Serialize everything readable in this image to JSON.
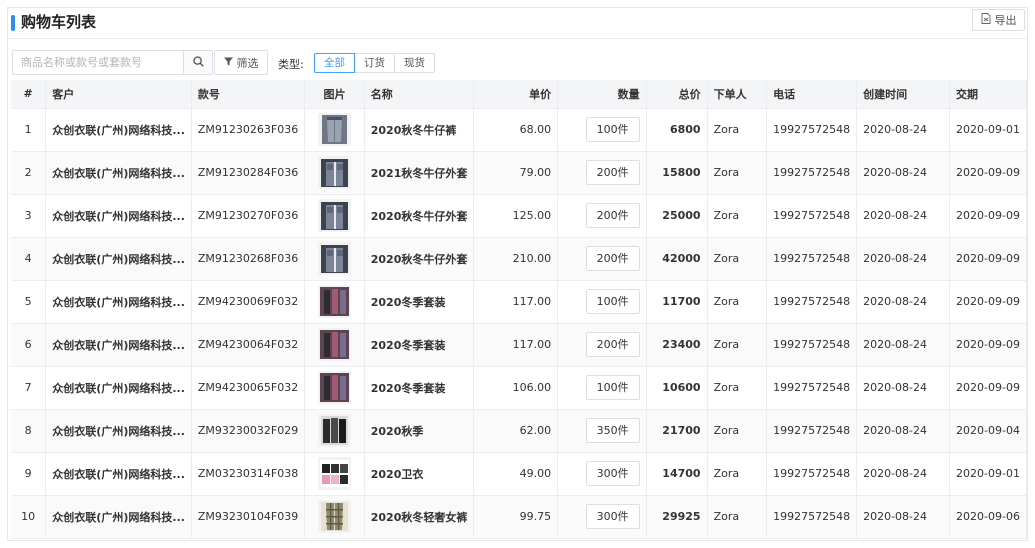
{
  "page": {
    "title": "购物车列表",
    "accent_color": "#2d8cf0",
    "export_label": "导出"
  },
  "toolbar": {
    "search_placeholder": "商品名称或款号或套款号",
    "filter_label": "筛选",
    "type_label": "类型:",
    "type_options": [
      "全部",
      "订货",
      "现货"
    ],
    "type_selected": "全部"
  },
  "table": {
    "columns": [
      "#",
      "客户",
      "款号",
      "图片",
      "名称",
      "单价",
      "数量",
      "总价",
      "下单人",
      "电话",
      "创建时间",
      "交期"
    ],
    "rows": [
      {
        "idx": "1",
        "customer": "众创衣联(广州)网络科技...",
        "sku": "ZM91230263F036",
        "thumb": "jeans-icon",
        "name": "2020秋冬牛仔裤",
        "price": "68.00",
        "qty": "100件",
        "total": "6800",
        "user": "Zora",
        "phone": "19927572548",
        "created": "2020-08-24",
        "delivery": "2020-09-01"
      },
      {
        "idx": "2",
        "customer": "众创衣联(广州)网络科技...",
        "sku": "ZM91230284F036",
        "thumb": "denim-jacket-icon",
        "name": "2021秋冬牛仔外套",
        "price": "79.00",
        "qty": "200件",
        "total": "15800",
        "user": "Zora",
        "phone": "19927572548",
        "created": "2020-08-24",
        "delivery": "2020-09-09"
      },
      {
        "idx": "3",
        "customer": "众创衣联(广州)网络科技...",
        "sku": "ZM91230270F036",
        "thumb": "denim-jacket-icon",
        "name": "2020秋冬牛仔外套",
        "price": "125.00",
        "qty": "200件",
        "total": "25000",
        "user": "Zora",
        "phone": "19927572548",
        "created": "2020-08-24",
        "delivery": "2020-09-09"
      },
      {
        "idx": "4",
        "customer": "众创衣联(广州)网络科技...",
        "sku": "ZM91230268F036",
        "thumb": "denim-jacket-icon",
        "name": "2020秋冬牛仔外套",
        "price": "210.00",
        "qty": "200件",
        "total": "42000",
        "user": "Zora",
        "phone": "19927572548",
        "created": "2020-08-24",
        "delivery": "2020-09-09"
      },
      {
        "idx": "5",
        "customer": "众创衣联(广州)网络科技...",
        "sku": "ZM94230069F032",
        "thumb": "winter-suit-icon",
        "name": "2020冬季套装",
        "price": "117.00",
        "qty": "100件",
        "total": "11700",
        "user": "Zora",
        "phone": "19927572548",
        "created": "2020-08-24",
        "delivery": "2020-09-09"
      },
      {
        "idx": "6",
        "customer": "众创衣联(广州)网络科技...",
        "sku": "ZM94230064F032",
        "thumb": "winter-suit-icon",
        "name": "2020冬季套装",
        "price": "117.00",
        "qty": "200件",
        "total": "23400",
        "user": "Zora",
        "phone": "19927572548",
        "created": "2020-08-24",
        "delivery": "2020-09-09"
      },
      {
        "idx": "7",
        "customer": "众创衣联(广州)网络科技...",
        "sku": "ZM94230065F032",
        "thumb": "winter-suit-icon",
        "name": "2020冬季套装",
        "price": "106.00",
        "qty": "100件",
        "total": "10600",
        "user": "Zora",
        "phone": "19927572548",
        "created": "2020-08-24",
        "delivery": "2020-09-09"
      },
      {
        "idx": "8",
        "customer": "众创衣联(广州)网络科技...",
        "sku": "ZM93230032F029",
        "thumb": "autumn-wear-icon",
        "name": "2020秋季",
        "price": "62.00",
        "qty": "350件",
        "total": "21700",
        "user": "Zora",
        "phone": "19927572548",
        "created": "2020-08-24",
        "delivery": "2020-09-04"
      },
      {
        "idx": "9",
        "customer": "众创衣联(广州)网络科技...",
        "sku": "ZM03230314F038",
        "thumb": "hoodie-icon",
        "name": "2020卫衣",
        "price": "49.00",
        "qty": "300件",
        "total": "14700",
        "user": "Zora",
        "phone": "19927572548",
        "created": "2020-08-24",
        "delivery": "2020-09-01"
      },
      {
        "idx": "10",
        "customer": "众创衣联(广州)网络科技...",
        "sku": "ZM93230104F039",
        "thumb": "plaid-pants-icon",
        "name": "2020秋冬轻奢女裤",
        "price": "99.75",
        "qty": "300件",
        "total": "29925",
        "user": "Zora",
        "phone": "19927572548",
        "created": "2020-08-24",
        "delivery": "2020-09-06"
      }
    ]
  }
}
